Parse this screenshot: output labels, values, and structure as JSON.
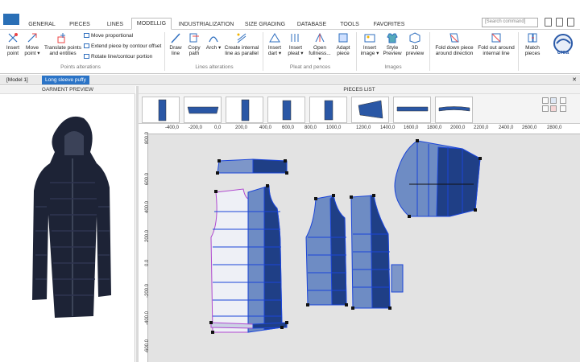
{
  "tabs": [
    "GENERAL",
    "PIECES",
    "LINES",
    "MODELLIG",
    "INDUSTRIALIZATION",
    "SIZE GRADING",
    "DATABASE",
    "TOOLS",
    "FAVORITES"
  ],
  "active_tab": "MODELLIG",
  "search": {
    "placeholder": "[Search command]"
  },
  "ribbon": {
    "points": {
      "insert_point": "Insert point",
      "move_point": "Move point ▾",
      "translate": "Translate points and entities",
      "move_proportional": "Move proportional",
      "extend_piece": "Extend piece by contour offset",
      "rotate_line": "Rotate line/contour portion",
      "group": "Points alterations"
    },
    "lines": {
      "draw": "Draw line",
      "copy": "Copy path",
      "arch": "Arch ▾",
      "create_parallel": "Create internal line as parallel",
      "group": "Lines alterations"
    },
    "pleat": {
      "insert_dart": "Insert dart ▾",
      "insert_pleat": "Insert pleat ▾",
      "open_fullness": "Open fullness... ▾",
      "adapt_piece": "Adapt piece",
      "group": "Pleat and pences"
    },
    "images": {
      "insert_image": "Insert image ▾",
      "style_preview": "Style Preview",
      "preview3d": "3D preview",
      "group": "Images"
    },
    "fold": {
      "fold_down": "Fold down piece around direction",
      "fold_out": "Fold out around internal line"
    },
    "match": {
      "match_pieces": "Match pieces"
    },
    "brand": "crea"
  },
  "doc_tabs": [
    "[Model 1]",
    "Long sleeve puffy"
  ],
  "garment_preview_title": "GARMENT PREVIEW",
  "pieces_list_title": "PIECES LIST",
  "ruler_x": [
    "-400,0",
    "-200,0",
    "0,0",
    "200,0",
    "400,0",
    "600,0",
    "800,0",
    "1000,0",
    "1200,0",
    "1400,0",
    "1600,0",
    "1800,0",
    "2000,0",
    "2200,0",
    "2400,0",
    "2600,0",
    "2800,0"
  ],
  "ruler_y": [
    "800,0",
    "600,0",
    "400,0",
    "200,0",
    "0,0",
    "-200,0",
    "-400,0",
    "-600,0"
  ],
  "colors": {
    "accent": "#2b74c7",
    "piece_light": "#6e8cc4",
    "piece_dark": "#1f3f86",
    "grid_line": "#1b45d8"
  }
}
